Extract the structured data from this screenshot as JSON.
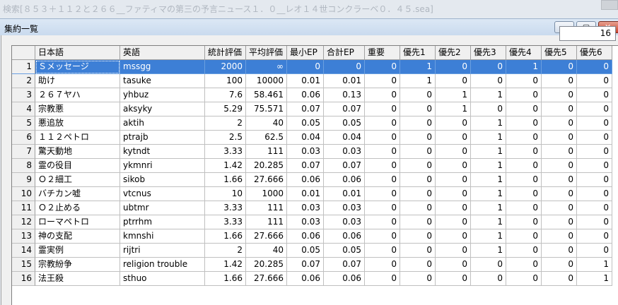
{
  "outer_window": {
    "title": "検索[８５３＋１１２と２６６__ファティマの第三の予言ニュース１．０__レオ１４世コンクラーベ０．４５.sea]"
  },
  "window": {
    "title": "集約一覧"
  },
  "count": "16",
  "columns": [
    "日本語",
    "英語",
    "統計評価",
    "平均評価",
    "最小EP",
    "合計EP",
    "重要",
    "優先1",
    "優先2",
    "優先3",
    "優先4",
    "優先5",
    "優先6"
  ],
  "rows": [
    [
      "1",
      "Ｓメッセージ",
      "mssgg",
      "2000",
      "∞",
      "0",
      "0",
      "0",
      "1",
      "0",
      "0",
      "1",
      "0",
      "0"
    ],
    [
      "2",
      "助け",
      "tasuke",
      "100",
      "10000",
      "0.01",
      "0.01",
      "0",
      "1",
      "0",
      "0",
      "0",
      "0",
      "0"
    ],
    [
      "3",
      "２６７ヤハ",
      "yhbuz",
      "7.6",
      "58.461",
      "0.06",
      "0.13",
      "0",
      "0",
      "1",
      "1",
      "0",
      "0",
      "0"
    ],
    [
      "4",
      "宗教悪",
      "aksyky",
      "5.29",
      "75.571",
      "0.07",
      "0.07",
      "0",
      "0",
      "1",
      "0",
      "0",
      "0",
      "0"
    ],
    [
      "5",
      "悪追放",
      "aktih",
      "2",
      "40",
      "0.05",
      "0.05",
      "0",
      "0",
      "0",
      "1",
      "0",
      "0",
      "0"
    ],
    [
      "6",
      "１１２ペトロ",
      "ptrajb",
      "2.5",
      "62.5",
      "0.04",
      "0.04",
      "0",
      "0",
      "0",
      "1",
      "0",
      "0",
      "0"
    ],
    [
      "7",
      "驚天動地",
      "kytndt",
      "3.33",
      "111",
      "0.03",
      "0.03",
      "0",
      "0",
      "0",
      "1",
      "0",
      "0",
      "0"
    ],
    [
      "8",
      "霊の役目",
      "ykmnri",
      "1.42",
      "20.285",
      "0.07",
      "0.07",
      "0",
      "0",
      "0",
      "1",
      "0",
      "0",
      "0"
    ],
    [
      "9",
      "Ｏ２細工",
      "sikob",
      "1.66",
      "27.666",
      "0.06",
      "0.06",
      "0",
      "0",
      "0",
      "1",
      "0",
      "0",
      "0"
    ],
    [
      "10",
      "バチカン嘘",
      "vtcnus",
      "10",
      "1000",
      "0.01",
      "0.01",
      "0",
      "0",
      "0",
      "1",
      "0",
      "0",
      "0"
    ],
    [
      "11",
      "Ｏ２止める",
      "ubtmr",
      "3.33",
      "111",
      "0.03",
      "0.03",
      "0",
      "0",
      "0",
      "1",
      "0",
      "0",
      "0"
    ],
    [
      "12",
      "ローマペトロ",
      "ptrrhm",
      "3.33",
      "111",
      "0.03",
      "0.03",
      "0",
      "0",
      "0",
      "1",
      "0",
      "0",
      "0"
    ],
    [
      "13",
      "神の支配",
      "kmnshi",
      "1.66",
      "27.666",
      "0.06",
      "0.06",
      "0",
      "0",
      "0",
      "1",
      "0",
      "0",
      "0"
    ],
    [
      "14",
      "霊実例",
      "rijtri",
      "2",
      "40",
      "0.05",
      "0.05",
      "0",
      "0",
      "0",
      "1",
      "0",
      "0",
      "0"
    ],
    [
      "15",
      "宗教紛争",
      "religion trouble",
      "1.42",
      "20.285",
      "0.07",
      "0.07",
      "0",
      "0",
      "0",
      "0",
      "0",
      "0",
      "1"
    ],
    [
      "16",
      "法王殺",
      "sthuo",
      "1.66",
      "27.666",
      "0.06",
      "0.06",
      "0",
      "0",
      "0",
      "0",
      "0",
      "0",
      "1"
    ]
  ],
  "selected_row": 0,
  "colors": {
    "selection": "#3d7fd6",
    "header_bg": "#f0f0f0",
    "close_button": "#c7432b"
  }
}
